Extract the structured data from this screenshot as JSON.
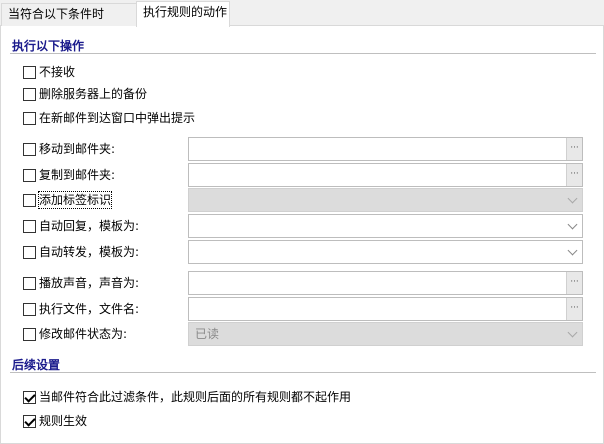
{
  "tabs": [
    {
      "label": "当符合以下条件时"
    },
    {
      "label": "执行规则的动作"
    }
  ],
  "actions_section": {
    "title": "执行以下操作",
    "items": [
      {
        "label": "不接收",
        "checked": false
      },
      {
        "label": "删除服务器上的备份",
        "checked": false
      },
      {
        "label": "在新邮件到达窗口中弹出提示",
        "checked": false
      },
      {
        "label": "移动到邮件夹:",
        "checked": false,
        "value": ""
      },
      {
        "label": "复制到邮件夹:",
        "checked": false,
        "value": ""
      },
      {
        "label": "添加标签标识",
        "checked": false,
        "value": ""
      },
      {
        "label": "自动回复，模板为:",
        "checked": false,
        "value": ""
      },
      {
        "label": "自动转发，模板为:",
        "checked": false,
        "value": ""
      },
      {
        "label": "播放声音，声音为:",
        "checked": false,
        "value": ""
      },
      {
        "label": "执行文件，文件名:",
        "checked": false,
        "value": ""
      },
      {
        "label": "修改邮件状态为:",
        "checked": false,
        "value": "已读"
      }
    ]
  },
  "followup_section": {
    "title": "后续设置",
    "items": [
      {
        "label": "当邮件符合此过滤条件，此规则后面的所有规则都不起作用",
        "checked": true
      },
      {
        "label": "规则生效",
        "checked": true
      }
    ]
  },
  "browse_label": "···"
}
